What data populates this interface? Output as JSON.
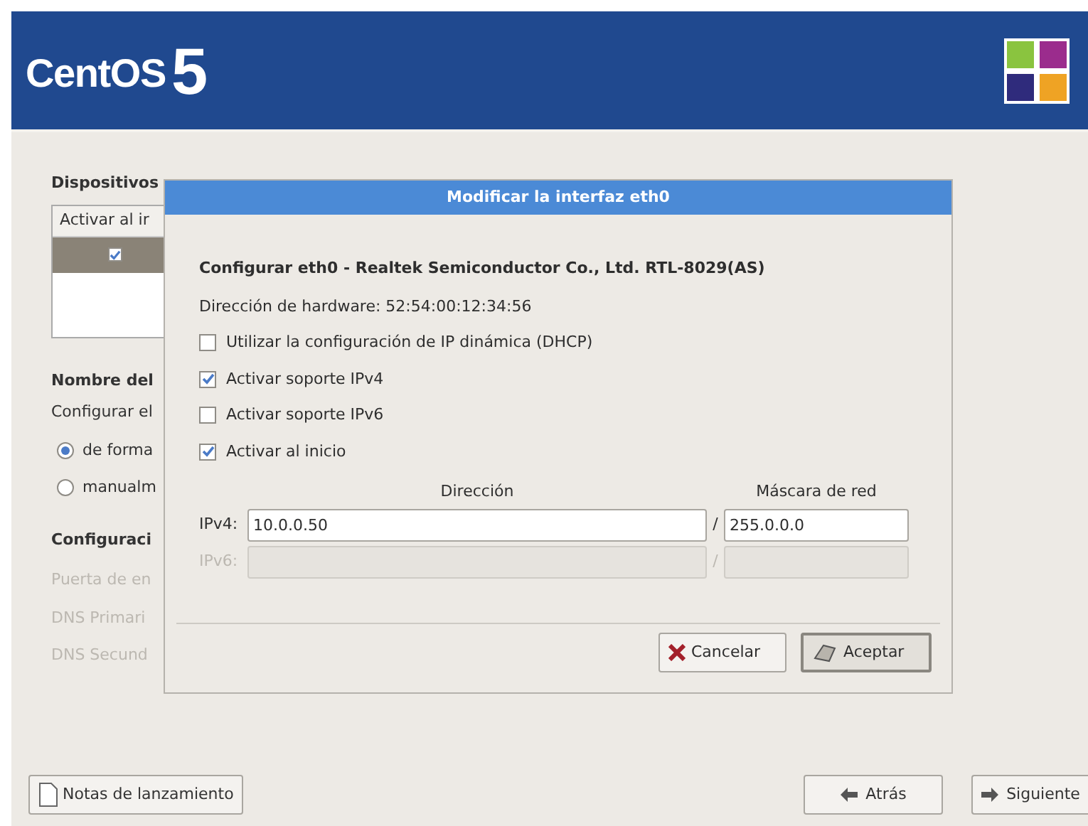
{
  "banner": {
    "logo_text": "CentOS",
    "logo_version": "5"
  },
  "background": {
    "devices_heading": "Dispositivos",
    "devices_column": "Activar al ir",
    "device_rows": [
      {
        "checked": true,
        "selected": true
      }
    ],
    "hostname_heading": "Nombre del",
    "hostname_hint": "Configurar el",
    "hostname_options": [
      {
        "label": "de forma",
        "selected": true
      },
      {
        "label": "manualm",
        "selected": false
      }
    ],
    "misc_heading": "Configuraci",
    "misc_fields": [
      {
        "label": "Puerta de en",
        "disabled": true
      },
      {
        "label": "DNS Primari",
        "disabled": true
      },
      {
        "label": "DNS Secund",
        "disabled": true
      }
    ]
  },
  "dialog": {
    "title": "Modificar la interfaz eth0",
    "heading": "Configurar eth0 - Realtek Semiconductor Co., Ltd. RTL-8029(AS)",
    "hardware": "Dirección de hardware: 52:54:00:12:34:56",
    "options": [
      {
        "label": "Utilizar la configuración de IP dinámica (DHCP)",
        "checked": false
      },
      {
        "label": "Activar soporte IPv4",
        "checked": true
      },
      {
        "label": "Activar soporte IPv6",
        "checked": false
      },
      {
        "label": "Activar al inicio",
        "checked": true
      }
    ],
    "columns": [
      "Dirección",
      "Máscara de red"
    ],
    "rows": [
      {
        "label": "IPv4:",
        "address": "10.0.0.50",
        "separator": "/",
        "mask": "255.0.0.0",
        "disabled": false
      },
      {
        "label": "IPv6:",
        "address": "",
        "separator": "/",
        "mask": "",
        "disabled": true
      }
    ],
    "buttons": [
      {
        "kind": "cancel",
        "label": "Cancelar"
      },
      {
        "kind": "ok",
        "label": "Aceptar"
      }
    ]
  },
  "footer": {
    "release_notes": "Notas de lanzamiento",
    "back": "Atrás",
    "next": "Siguiente"
  }
}
